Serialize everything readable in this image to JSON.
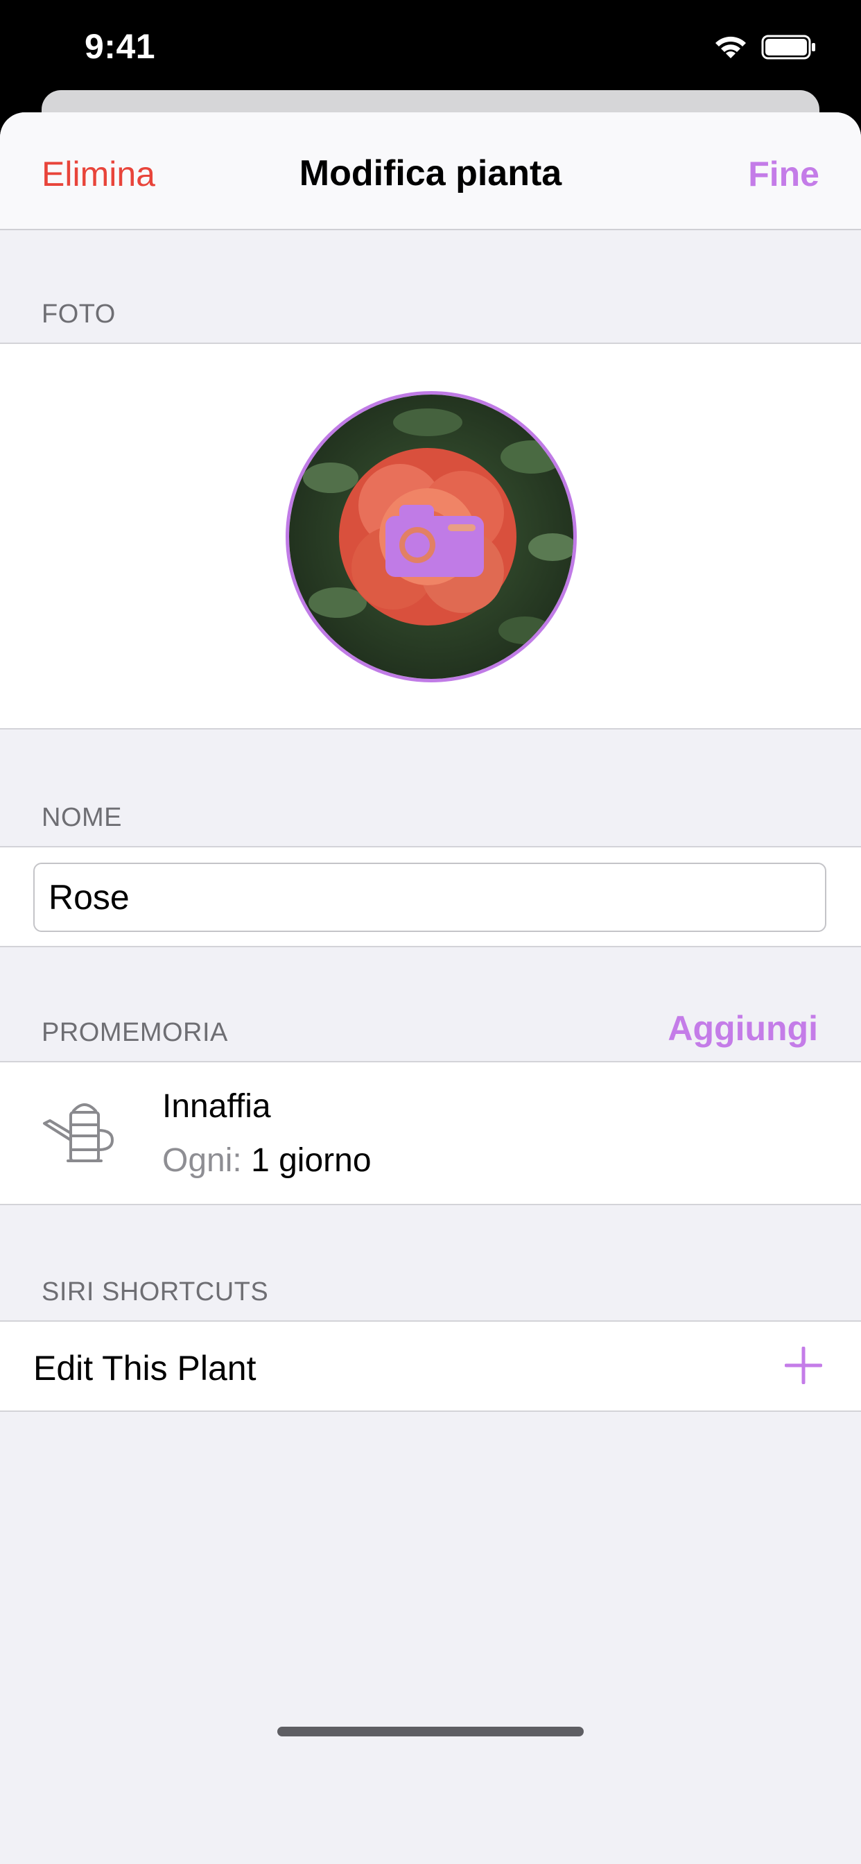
{
  "status_bar": {
    "time": "9:41"
  },
  "nav": {
    "left_label": "Elimina",
    "title": "Modifica pianta",
    "right_label": "Fine"
  },
  "photo": {
    "header": "FOTO"
  },
  "name": {
    "header": "NOME",
    "value": "Rose"
  },
  "reminders": {
    "header": "PROMEMORIA",
    "add_label": "Aggiungi",
    "items": [
      {
        "title": "Innaffia",
        "frequency_label": "Ogni:",
        "frequency_value": "1 giorno",
        "icon": "watering-can-icon"
      }
    ]
  },
  "siri": {
    "header": "SIRI SHORTCUTS",
    "item_label": "Edit This Plant",
    "add_icon": "plus-icon"
  },
  "colors": {
    "accent": "#c47ce8",
    "destructive": "#e8443a",
    "background": "#f1f1f6"
  }
}
